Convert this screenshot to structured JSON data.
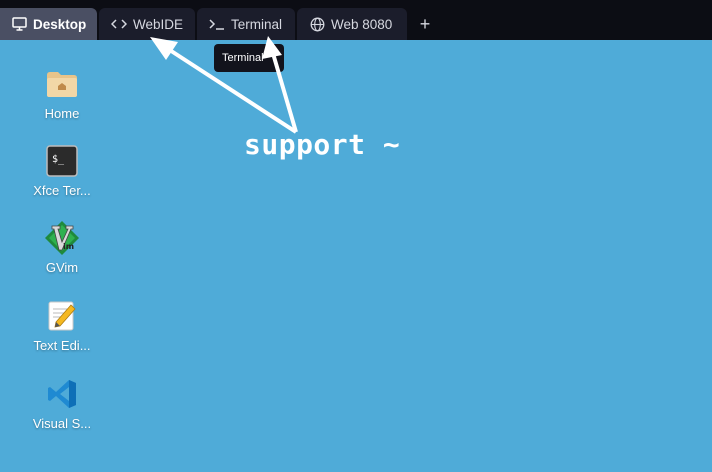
{
  "tabs": [
    {
      "label": "Desktop",
      "icon": "monitor-icon"
    },
    {
      "label": "WebIDE",
      "icon": "code-icon"
    },
    {
      "label": "Terminal",
      "icon": "terminal-prompt-icon"
    },
    {
      "label": "Web 8080",
      "icon": "globe-icon"
    }
  ],
  "add_tab_label": "+",
  "tooltip": "Terminal",
  "desktop_icons": [
    {
      "label": "Home",
      "icon": "home-folder-icon"
    },
    {
      "label": "Xfce Ter...",
      "icon": "terminal-app-icon"
    },
    {
      "label": "GVim",
      "icon": "gvim-icon"
    },
    {
      "label": "Text Edi...",
      "icon": "text-editor-icon"
    },
    {
      "label": "Visual S...",
      "icon": "vscode-icon"
    }
  ],
  "annotation": "support ~",
  "colors": {
    "desktop_bg": "#4fabd8",
    "tabbar_bg": "#0c0d14",
    "active_tab": "#4a4f63"
  }
}
